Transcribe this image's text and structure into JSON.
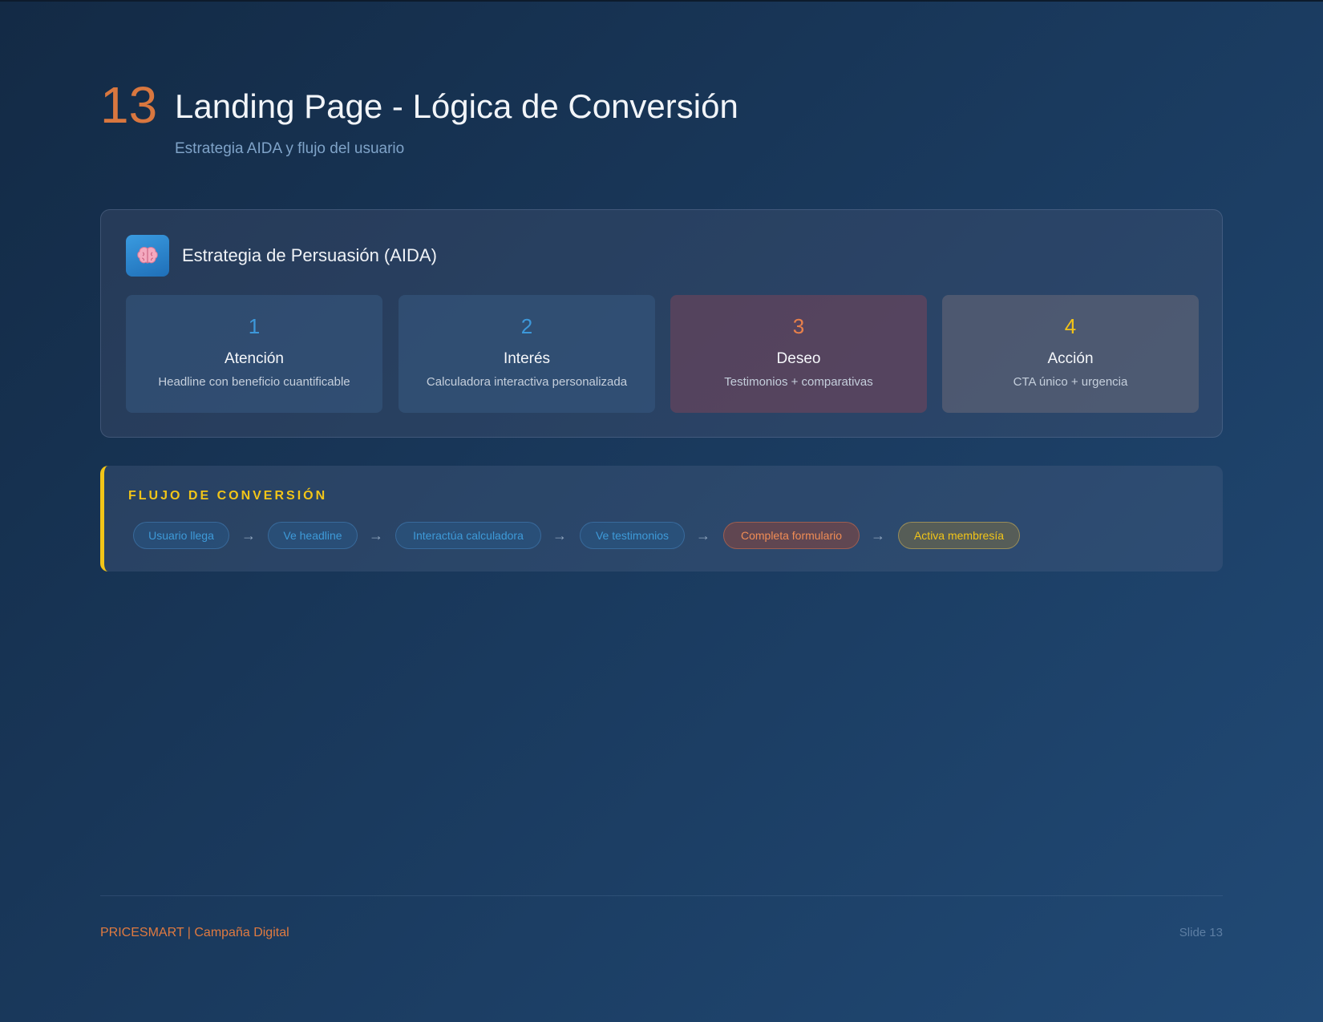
{
  "header": {
    "slide_number": "13",
    "title": "Landing Page - Lógica de Conversión",
    "subtitle": "Estrategia AIDA y flujo del usuario"
  },
  "aida": {
    "icon": "brain-icon",
    "title": "Estrategia de Persuasión (AIDA)",
    "steps": [
      {
        "number": "1",
        "name": "Atención",
        "description": "Headline con beneficio cuantificable",
        "accent": "#3d98da"
      },
      {
        "number": "2",
        "name": "Interés",
        "description": "Calculadora interactiva personalizada",
        "accent": "#3d98da"
      },
      {
        "number": "3",
        "name": "Deseo",
        "description": "Testimonios + comparativas",
        "accent": "#e8804a"
      },
      {
        "number": "4",
        "name": "Acción",
        "description": "CTA único + urgencia",
        "accent": "#f2c318"
      }
    ]
  },
  "flow": {
    "label": "FLUJO DE CONVERSIÓN",
    "arrow": "→",
    "steps": [
      {
        "label": "Usuario llega",
        "style": "blue"
      },
      {
        "label": "Ve headline",
        "style": "blue"
      },
      {
        "label": "Interactúa calculadora",
        "style": "blue"
      },
      {
        "label": "Ve testimonios",
        "style": "blue"
      },
      {
        "label": "Completa formulario",
        "style": "orange"
      },
      {
        "label": "Activa membresía",
        "style": "yellow"
      }
    ]
  },
  "footer": {
    "brand": "PRICESMART | Campaña Digital",
    "slide_label": "Slide 13"
  },
  "colors": {
    "accent_orange": "#d9773f",
    "accent_yellow": "#f2c518",
    "accent_blue": "#3d98da"
  }
}
